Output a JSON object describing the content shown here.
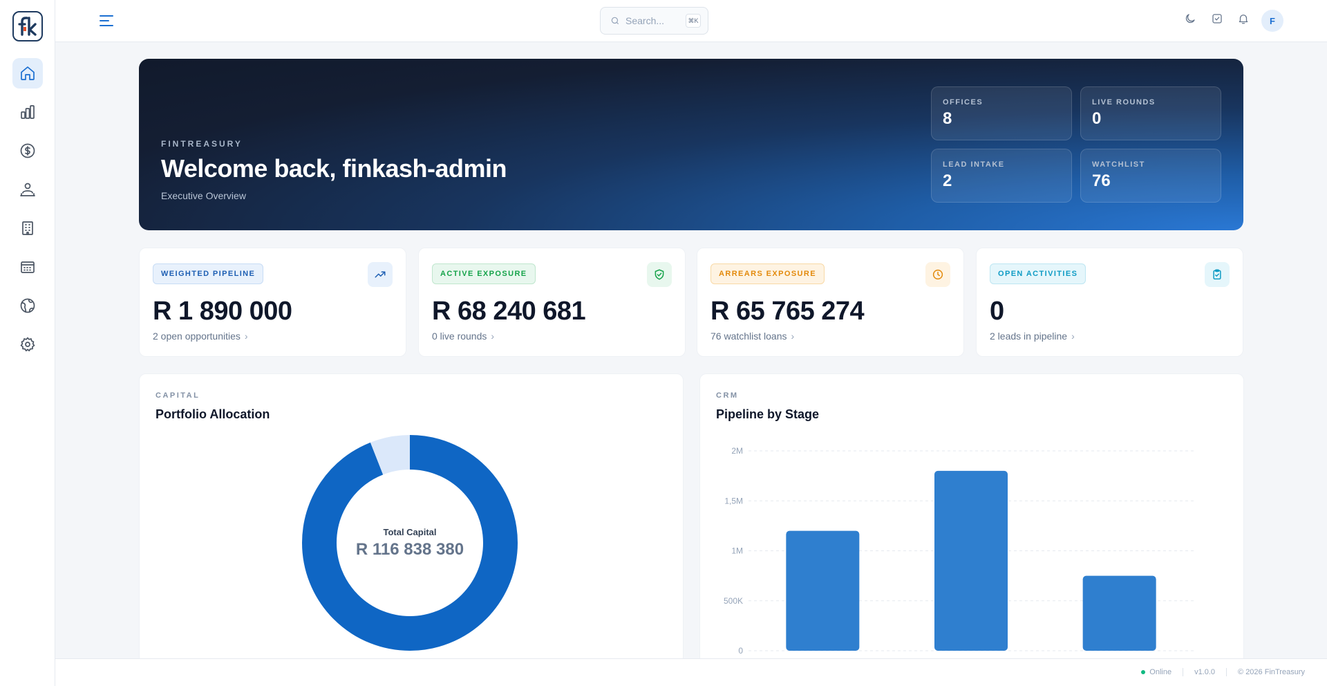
{
  "topbar": {
    "search_placeholder": "Search...",
    "search_shortcut": "⌘K",
    "avatar_initial": "F"
  },
  "sidebar": {
    "logo_text": "fk",
    "items": [
      {
        "name": "home",
        "icon": "home-icon",
        "active": true
      },
      {
        "name": "analytics",
        "icon": "bar-chart-icon"
      },
      {
        "name": "finance",
        "icon": "dollar-circle-icon"
      },
      {
        "name": "clients",
        "icon": "users-icon"
      },
      {
        "name": "offices",
        "icon": "building-icon"
      },
      {
        "name": "calendar",
        "icon": "calendar-icon"
      },
      {
        "name": "global",
        "icon": "globe-icon"
      },
      {
        "name": "settings",
        "icon": "gear-icon"
      }
    ]
  },
  "hero": {
    "brand": "FINTREASURY",
    "title": "Welcome back, finkash-admin",
    "subtitle": "Executive Overview",
    "stats": [
      {
        "label": "OFFICES",
        "value": "8"
      },
      {
        "label": "LIVE ROUNDS",
        "value": "0"
      },
      {
        "label": "LEAD INTAKE",
        "value": "2"
      },
      {
        "label": "WATCHLIST",
        "value": "76"
      }
    ]
  },
  "kpis": [
    {
      "badge": "WEIGHTED PIPELINE",
      "amount": "R 1 890 000",
      "sub": "2 open opportunities",
      "icon": "trending-up-icon",
      "color": "#1e5fb3",
      "bg": "#e8f1fc",
      "border": "#c7dcf5"
    },
    {
      "badge": "ACTIVE EXPOSURE",
      "amount": "R 68 240 681",
      "sub": "0 live rounds",
      "icon": "shield-check-icon",
      "color": "#16a34a",
      "bg": "#e8f7ee",
      "border": "#bfe6cd"
    },
    {
      "badge": "ARREARS EXPOSURE",
      "amount": "R 65 765 274",
      "sub": "76 watchlist loans",
      "icon": "clock-icon",
      "color": "#e38a0c",
      "bg": "#fef3e2",
      "border": "#f8d9a6"
    },
    {
      "badge": "OPEN ACTIVITIES",
      "amount": "0",
      "sub": "2 leads in pipeline",
      "icon": "clipboard-check-icon",
      "color": "#0f9bc4",
      "bg": "#e5f6fb",
      "border": "#bde6f2"
    }
  ],
  "capital_panel": {
    "eyebrow": "CAPITAL",
    "title": "Portfolio Allocation",
    "center_label": "Total Capital",
    "center_value": "R 116 838 380"
  },
  "crm_panel": {
    "eyebrow": "CRM",
    "title": "Pipeline by Stage"
  },
  "chart_data": [
    {
      "type": "pie",
      "title": "Portfolio Allocation",
      "total": "R 116 838 380",
      "values": [
        0.94,
        0.06
      ],
      "colors": [
        "#0f66c4",
        "#dbe8fa"
      ]
    },
    {
      "type": "bar",
      "title": "Pipeline by Stage",
      "values": [
        1200000,
        1800000,
        750000
      ],
      "ylim": [
        0,
        2000000
      ],
      "yticks": [
        "0",
        "500K",
        "1M",
        "1,5M",
        "2M"
      ],
      "grid": true,
      "colors": [
        "#2f7fcf"
      ]
    }
  ],
  "footer": {
    "status": "Online",
    "version": "v1.0.0",
    "copyright": "© 2026 FinTreasury"
  }
}
